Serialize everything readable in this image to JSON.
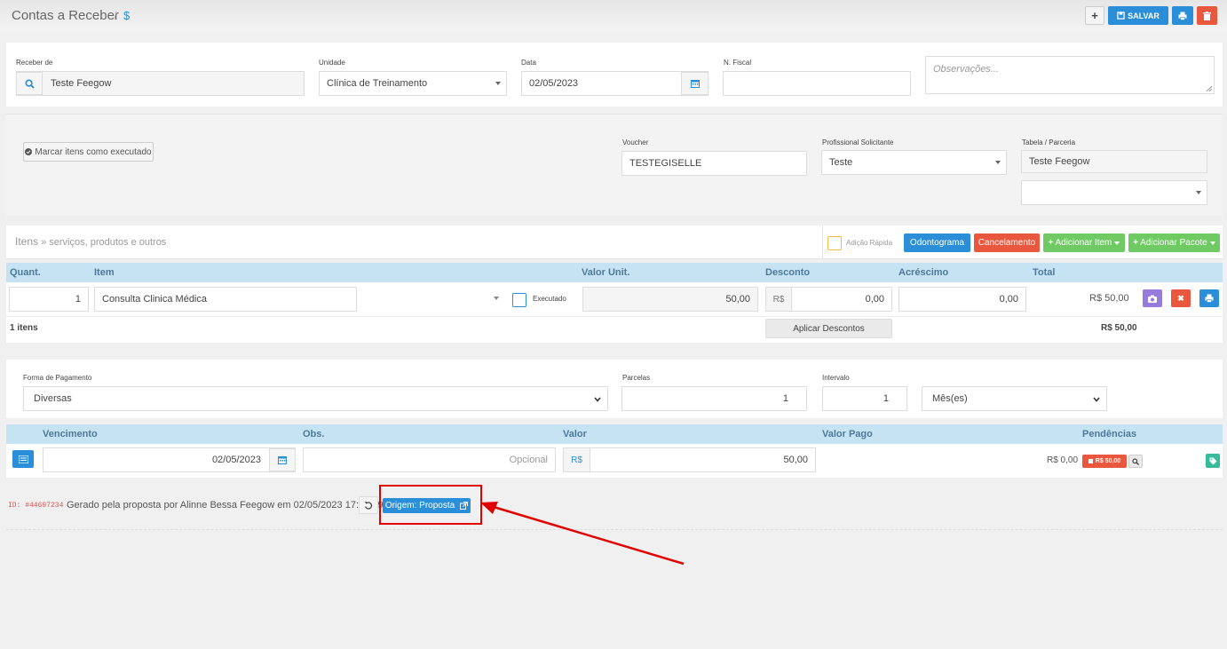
{
  "header": {
    "title": "Contas a Receber",
    "sep": "/",
    "dollar": "$",
    "save_label": "SALVAR",
    "plus": "+"
  },
  "receipt": {
    "receber_de_label": "Receber de",
    "receber_de_value": "Teste Feegow",
    "unidade_label": "Unidade",
    "unidade_value": "Clínica de Treinamento",
    "data_label": "Data",
    "data_value": "02/05/2023",
    "nfiscal_label": "N. Fiscal",
    "nfiscal_value": "",
    "obs_placeholder": "Observações..."
  },
  "details": {
    "mark_executed": "Marcar itens como executado",
    "voucher_label": "Voucher",
    "voucher_value": "TESTEGISELLE",
    "prof_label": "Profissional Solicitante",
    "prof_value": "Teste",
    "tabela_label": "Tabela / Parceria",
    "tabela_value": "Teste Feegow",
    "tabela_select_value": ""
  },
  "items_toolbar": {
    "title": "Itens",
    "subtitle": " » serviços, produtos e outros",
    "quick_add": "Adição Rápida",
    "odontograma": "Odontograma",
    "cancelamento": "Cancelamento",
    "add_item": "Adicionar Item",
    "add_package": "Adicionar Pacote"
  },
  "items_table": {
    "headers": {
      "quant": "Quant.",
      "item": "Item",
      "valor_unit": "Valor Unit.",
      "desconto": "Desconto",
      "acrescimo": "Acréscimo",
      "total": "Total"
    },
    "rows": [
      {
        "quant": "1",
        "item": "Consulta Clinica Médica",
        "executado": "Executado",
        "valor_unit": "50,00",
        "currency": "R$",
        "desconto": "0,00",
        "acrescimo": "0,00",
        "total": "R$ 50,00"
      }
    ],
    "count": "1 itens",
    "apply_discounts": "Aplicar Descontos",
    "grand_total": "R$ 50,00"
  },
  "payment": {
    "forma_label": "Forma de Pagamento",
    "forma_value": "Diversas",
    "parcelas_label": "Parcelas",
    "parcelas_value": "1",
    "intervalo_label": "Intervalo",
    "intervalo_value": "1",
    "periodo_value": "Mês(es)"
  },
  "installments": {
    "headers": {
      "vencimento": "Vencimento",
      "obs": "Obs.",
      "valor": "Valor",
      "valor_pago": "Valor Pago",
      "pendencias": "Pendências"
    },
    "rows": [
      {
        "vencimento": "02/05/2023",
        "obs_placeholder": "Opcional",
        "currency": "R$",
        "valor": "50,00",
        "valor_pago": "R$ 0,00",
        "pendencia": "R$ 50,00"
      }
    ]
  },
  "footer": {
    "id": "ID: #44697234",
    "generated": "Gerado pela proposta por Alinne Bessa Feegow em 02/05/2023 17:53:09",
    "origin_button": "Origem: Proposta"
  },
  "colors": {
    "primary": "#2a8fd8",
    "danger": "#e9573f",
    "success": "#70ca63",
    "purple": "#967adc",
    "highlight": "#e00000",
    "table_header": "#c6e3f4"
  }
}
